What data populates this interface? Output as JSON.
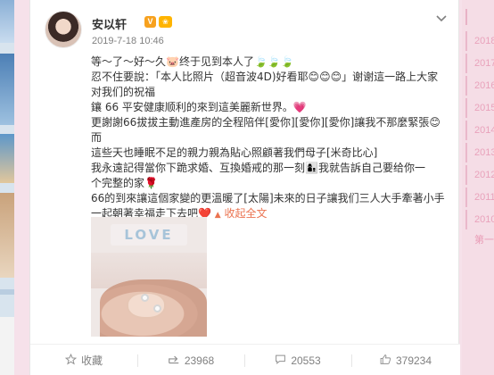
{
  "year_sidebar": {
    "items": [
      "2018",
      "2017",
      "2016",
      "2015",
      "2014",
      "2013",
      "2012",
      "2011",
      "2010"
    ],
    "tail_label": "第一"
  },
  "post": {
    "username": "安以轩",
    "vip_badge": "V",
    "fan_badge": "❀",
    "timestamp": "2019-7-18 10:46",
    "text_lines": [
      "等～了～好～久🐷终于见到本人了🍃🍃🍃",
      "忍不住要說：「本人比照片（超音波4D)好看耶😊😊😊」谢谢這一路上大家",
      "对我们的祝福",
      "鑲 66 平安健康顺利的來到這美麗新世界。💗",
      "更謝謝66拔拔主動進產房的全程陪伴[愛你][愛你][愛你]讓我不那麼緊張😊而",
      "這些天也睡眠不足的親力親為貼心照顧著我們母子[米奇比心]",
      "我永遠記得當你下跪求婚、互換婚戒的那一刻👩‍👦我就告訴自己要给你一",
      "个完整的家🌹",
      "66的到來讓這個家變的更溫暖了[太陽]未來的日子讓我们三人大手牽著小手",
      "一起朝著幸福走下去吧❤️"
    ],
    "collapse_label": "收起全文",
    "photo_banner_text": "LOVE"
  },
  "actions": {
    "favorite_label": "收藏",
    "forward_count": "23968",
    "comment_count": "20553",
    "like_count": "379234"
  },
  "icons": {
    "more": "chevron-down-icon",
    "favorite": "star-icon",
    "forward": "forward-icon",
    "comment": "comment-icon",
    "like": "thumbs-up-icon"
  },
  "colors": {
    "accent": "#eb7350",
    "sidebar_text": "#e9a2bb",
    "background": "#f6e1ea"
  }
}
